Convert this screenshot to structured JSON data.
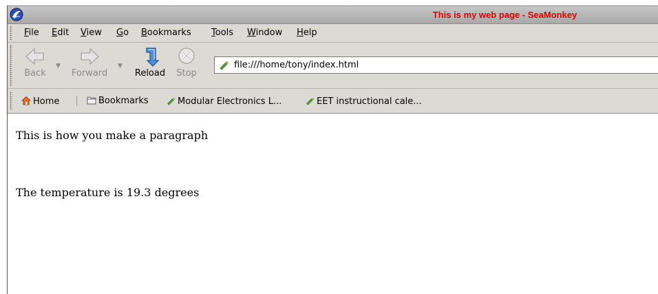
{
  "window": {
    "title": "This is my web page - SeaMonkey",
    "title_color": "#e00000"
  },
  "menu": {
    "items": [
      {
        "label": "File"
      },
      {
        "label": "Edit"
      },
      {
        "label": "View"
      },
      {
        "label": "Go"
      },
      {
        "label": "Bookmarks"
      },
      {
        "label": "Tools"
      },
      {
        "label": "Window"
      },
      {
        "label": "Help"
      }
    ]
  },
  "nav": {
    "back_label": "Back",
    "forward_label": "Forward",
    "reload_label": "Reload",
    "stop_label": "Stop",
    "url": "file:///home/tony/index.html"
  },
  "bookmarks": {
    "home_label": "Home",
    "bookmarks_label": "Bookmarks",
    "item1": "Modular Electronics L...",
    "item2": "EET instructional cale..."
  },
  "page": {
    "paragraph1": "This is how you make a paragraph",
    "paragraph2": "The temperature is 19.3 degrees"
  }
}
